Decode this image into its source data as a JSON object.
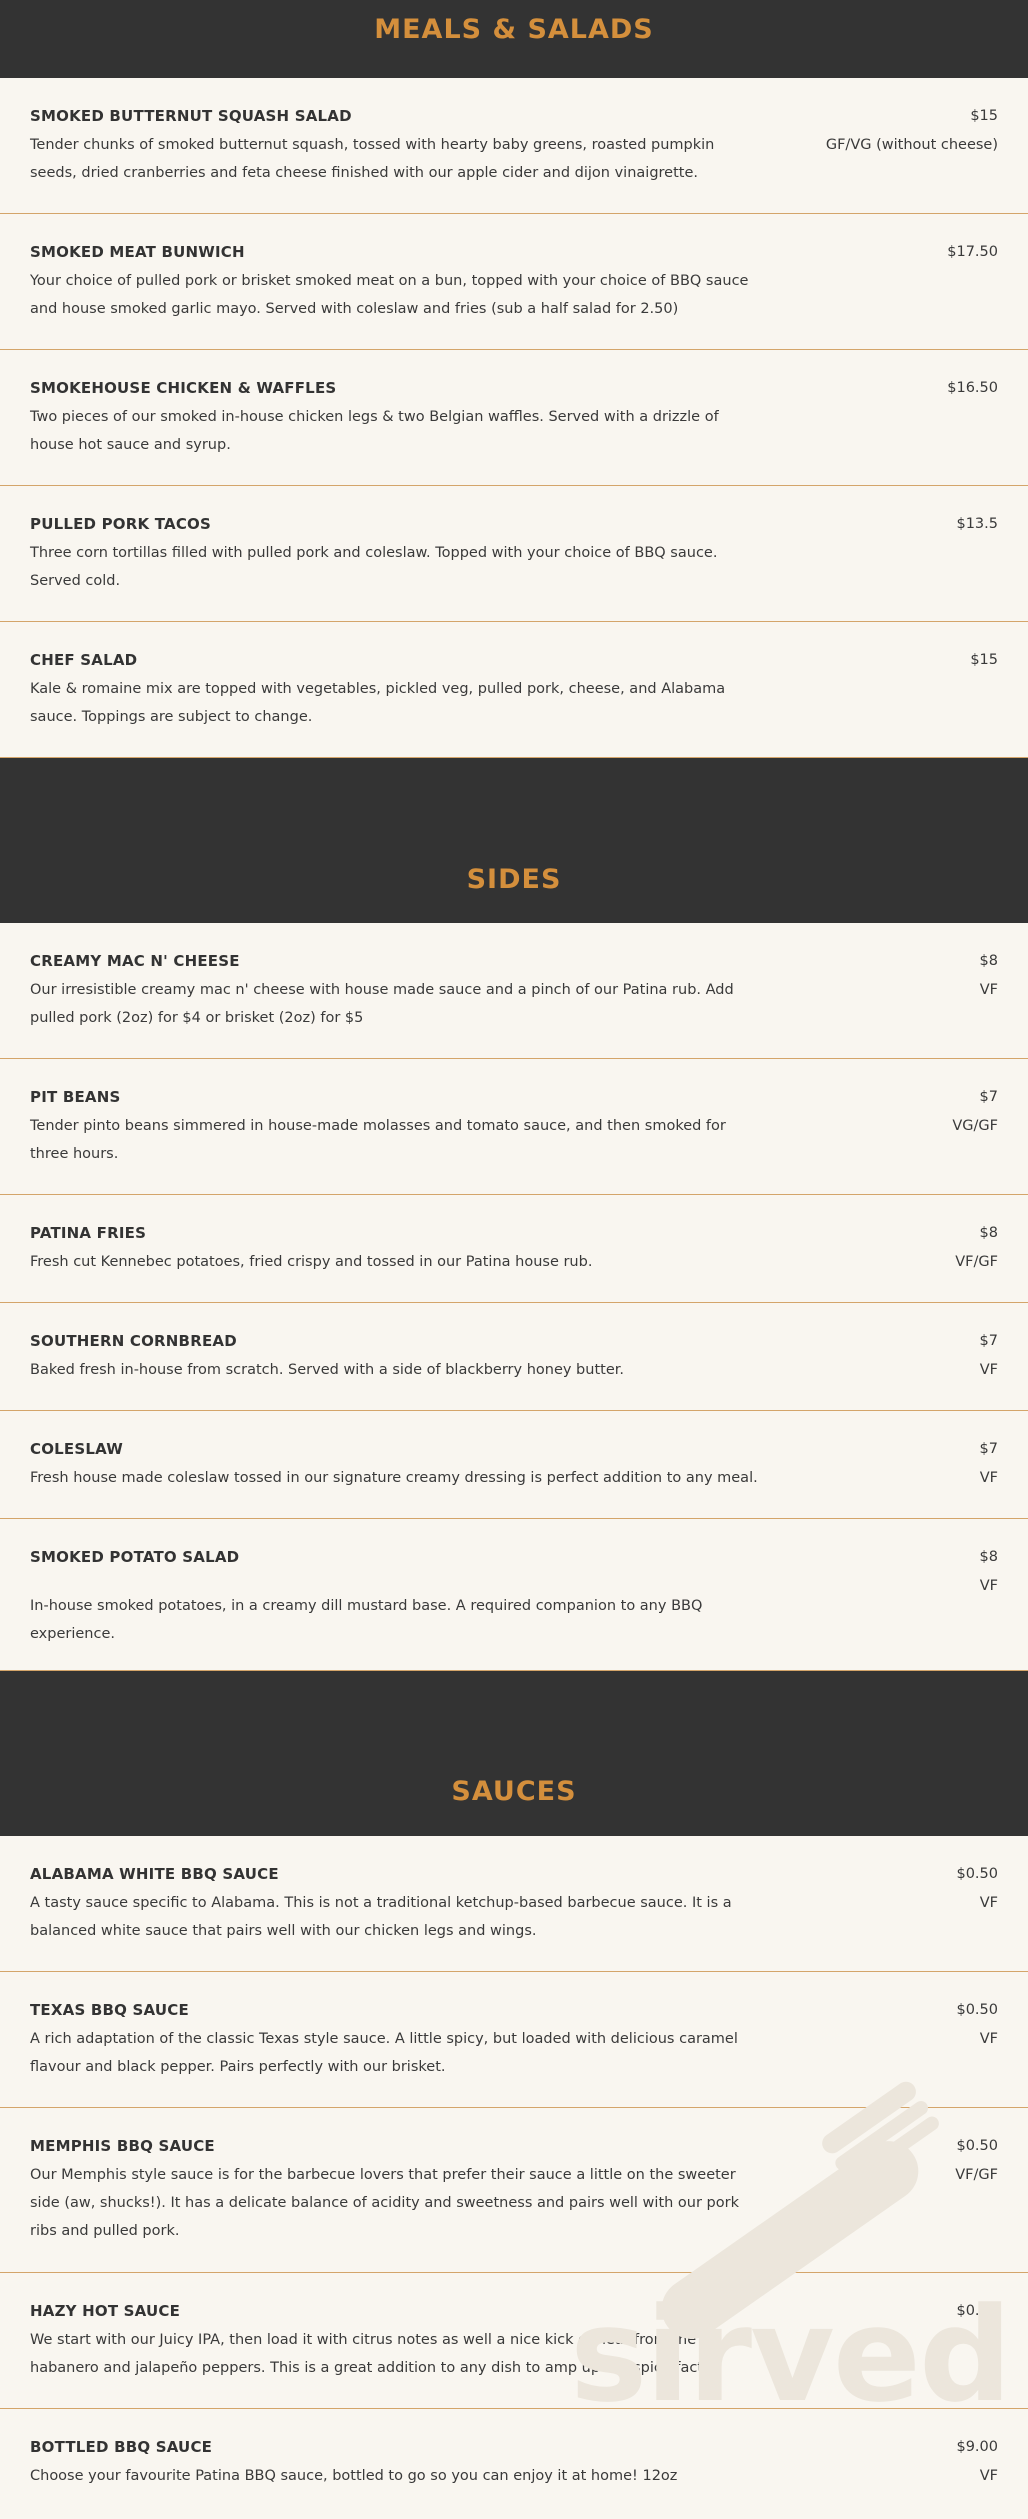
{
  "sections": [
    {
      "title": "MEALS & SALADS",
      "items": [
        {
          "name": "SMOKED BUTTERNUT SQUASH SALAD",
          "desc": "Tender chunks of smoked butternut squash, tossed with hearty baby greens, roasted pumpkin seeds, dried cranberries and feta cheese finished with our apple cider and dijon vinaigrette.",
          "price": "$15",
          "tag": "GF/VG (without cheese)"
        },
        {
          "name": "SMOKED MEAT BUNWICH",
          "desc": "Your choice of pulled pork or brisket smoked meat on a bun, topped with your choice of BBQ sauce and house smoked garlic mayo. Served with coleslaw and fries (sub a half salad for 2.50)",
          "price": "$17.50",
          "tag": ""
        },
        {
          "name": "SMOKEHOUSE CHICKEN & WAFFLES",
          "desc": "Two pieces of our smoked in-house chicken legs & two Belgian waffles. Served with a drizzle of house hot sauce and syrup.",
          "price": "$16.50",
          "tag": ""
        },
        {
          "name": "PULLED PORK TACOS",
          "desc": "Three corn tortillas filled with pulled pork and coleslaw. Topped with your choice of BBQ sauce. Served cold.",
          "price": "$13.5",
          "tag": ""
        },
        {
          "name": "CHEF SALAD",
          "desc": "Kale & romaine mix are topped with vegetables, pickled veg, pulled pork, cheese, and Alabama sauce. Toppings are subject to change.",
          "price": "$15",
          "tag": ""
        }
      ]
    },
    {
      "title": "SIDES",
      "items": [
        {
          "name": "CREAMY MAC N' CHEESE",
          "desc": "Our irresistible creamy mac n' cheese with house made sauce and a pinch of our Patina rub. Add pulled pork (2oz) for $4 or brisket (2oz) for $5",
          "price": "$8",
          "tag": "VF"
        },
        {
          "name": "PIT BEANS",
          "desc": "Tender pinto beans simmered in house-made molasses and tomato sauce, and then smoked for three hours.",
          "price": "$7",
          "tag": "VG/GF"
        },
        {
          "name": "PATINA FRIES",
          "desc": "Fresh cut Kennebec potatoes, fried crispy and tossed in our Patina house rub.",
          "price": "$8",
          "tag": "VF/GF"
        },
        {
          "name": "SOUTHERN CORNBREAD",
          "desc": "Baked fresh in-house from scratch. Served with a side of blackberry honey butter.",
          "price": "$7",
          "tag": "VF"
        },
        {
          "name": "COLESLAW",
          "desc": "Fresh house made coleslaw tossed in our signature creamy dressing is perfect addition to any meal.",
          "price": "$7",
          "tag": "VF"
        },
        {
          "name": "SMOKED POTATO SALAD",
          "desc": "In-house smoked potatoes, in a creamy dill mustard base. A required companion to any BBQ experience.",
          "price": "$8",
          "tag": "VF"
        }
      ]
    },
    {
      "title": "SAUCES",
      "items": [
        {
          "name": "ALABAMA WHITE BBQ SAUCE",
          "desc": "A tasty sauce specific to Alabama. This is not a traditional ketchup-based barbecue sauce. It is a balanced white sauce that pairs well with our chicken legs and wings.",
          "price": "$0.50",
          "tag": "VF"
        },
        {
          "name": "TEXAS BBQ SAUCE",
          "desc": "A rich adaptation of the classic Texas style sauce. A little spicy, but loaded with delicious caramel flavour and black pepper. Pairs perfectly with our brisket.",
          "price": "$0.50",
          "tag": "VF"
        },
        {
          "name": "MEMPHIS BBQ SAUCE",
          "desc": "Our Memphis style sauce is for the barbecue lovers that prefer their sauce a little on the sweeter side (aw, shucks!). It has a delicate balance of acidity and sweetness and pairs well with our pork ribs and pulled pork.",
          "price": "$0.50",
          "tag": "VF/GF"
        },
        {
          "name": "HAZY HOT SAUCE",
          "desc": "We start with our Juicy IPA, then load it with citrus notes as well a nice kick of heat from the habanero and jalapeño peppers. This is a great addition to any dish to amp up the spice factor.",
          "price": "$0.50",
          "tag": "VF"
        },
        {
          "name": "BOTTLED BBQ SAUCE",
          "desc": "Choose your favourite Patina BBQ sauce, bottled to go so you can enjoy it at home! 12oz",
          "price": "$9.00",
          "tag": "VF"
        }
      ]
    }
  ],
  "watermark": {
    "text": "sirved",
    "icon": "knife-fork-icon"
  },
  "colors": {
    "header_bg": "#333333",
    "accent": "#d48f3c",
    "page_bg": "#f9f6f0",
    "divider": "#d4a56a"
  }
}
